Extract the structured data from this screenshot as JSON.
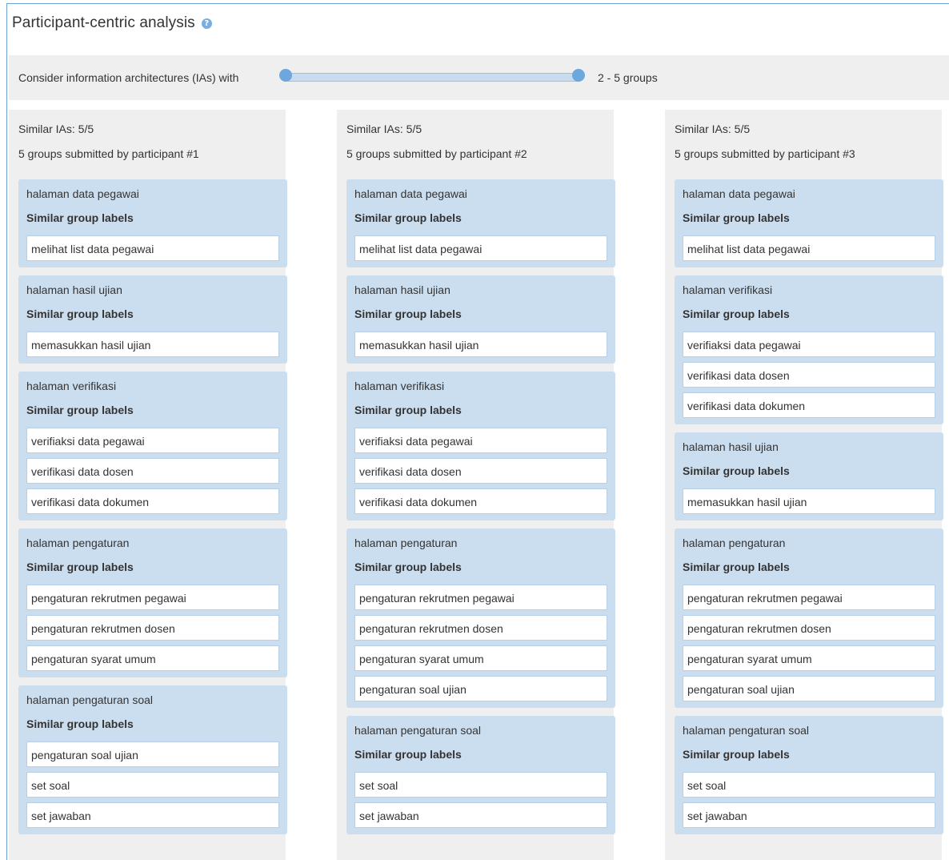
{
  "title": "Participant-centric analysis",
  "filter": {
    "label": "Consider information architectures (IAs) with",
    "range": "2 - 5 groups",
    "min": 2,
    "max": 5
  },
  "columns": [
    {
      "similar": "Similar IAs: 5/5",
      "subtitle": "5 groups submitted by participant #1",
      "groups": [
        {
          "name": "halaman data pegawai",
          "sub": "Similar group labels",
          "labels": [
            "melihat list data pegawai"
          ]
        },
        {
          "name": "halaman hasil ujian",
          "sub": "Similar group labels",
          "labels": [
            "memasukkan hasil ujian"
          ]
        },
        {
          "name": "halaman verifikasi",
          "sub": "Similar group labels",
          "labels": [
            "verifiaksi data pegawai",
            "verifikasi data dosen",
            "verifikasi data dokumen"
          ]
        },
        {
          "name": "halaman pengaturan",
          "sub": "Similar group labels",
          "labels": [
            "pengaturan rekrutmen pegawai",
            "pengaturan rekrutmen dosen",
            "pengaturan syarat umum"
          ]
        },
        {
          "name": "halaman pengaturan soal",
          "sub": "Similar group labels",
          "labels": [
            "pengaturan soal ujian",
            "set soal",
            "set jawaban"
          ]
        }
      ]
    },
    {
      "similar": "Similar IAs: 5/5",
      "subtitle": "5 groups submitted by participant #2",
      "groups": [
        {
          "name": "halaman data pegawai",
          "sub": "Similar group labels",
          "labels": [
            "melihat list data pegawai"
          ]
        },
        {
          "name": "halaman hasil ujian",
          "sub": "Similar group labels",
          "labels": [
            "memasukkan hasil ujian"
          ]
        },
        {
          "name": "halaman verifikasi",
          "sub": "Similar group labels",
          "labels": [
            "verifiaksi data pegawai",
            "verifikasi data dosen",
            "verifikasi data dokumen"
          ]
        },
        {
          "name": "halaman pengaturan",
          "sub": "Similar group labels",
          "labels": [
            "pengaturan rekrutmen pegawai",
            "pengaturan rekrutmen dosen",
            "pengaturan syarat umum",
            "pengaturan soal ujian"
          ]
        },
        {
          "name": "halaman pengaturan soal",
          "sub": "Similar group labels",
          "labels": [
            "set soal",
            "set jawaban"
          ]
        }
      ]
    },
    {
      "similar": "Similar IAs: 5/5",
      "subtitle": "5 groups submitted by participant #3",
      "groups": [
        {
          "name": "halaman data pegawai",
          "sub": "Similar group labels",
          "labels": [
            "melihat list data pegawai"
          ]
        },
        {
          "name": "halaman verifikasi",
          "sub": "Similar group labels",
          "labels": [
            "verifiaksi data pegawai",
            "verifikasi data dosen",
            "verifikasi data dokumen"
          ]
        },
        {
          "name": "halaman hasil ujian",
          "sub": "Similar group labels",
          "labels": [
            "memasukkan hasil ujian"
          ]
        },
        {
          "name": "halaman pengaturan",
          "sub": "Similar group labels",
          "labels": [
            "pengaturan rekrutmen pegawai",
            "pengaturan rekrutmen dosen",
            "pengaturan syarat umum",
            "pengaturan soal ujian"
          ]
        },
        {
          "name": "halaman pengaturan soal",
          "sub": "Similar group labels",
          "labels": [
            "set soal",
            "set jawaban"
          ]
        }
      ]
    }
  ]
}
